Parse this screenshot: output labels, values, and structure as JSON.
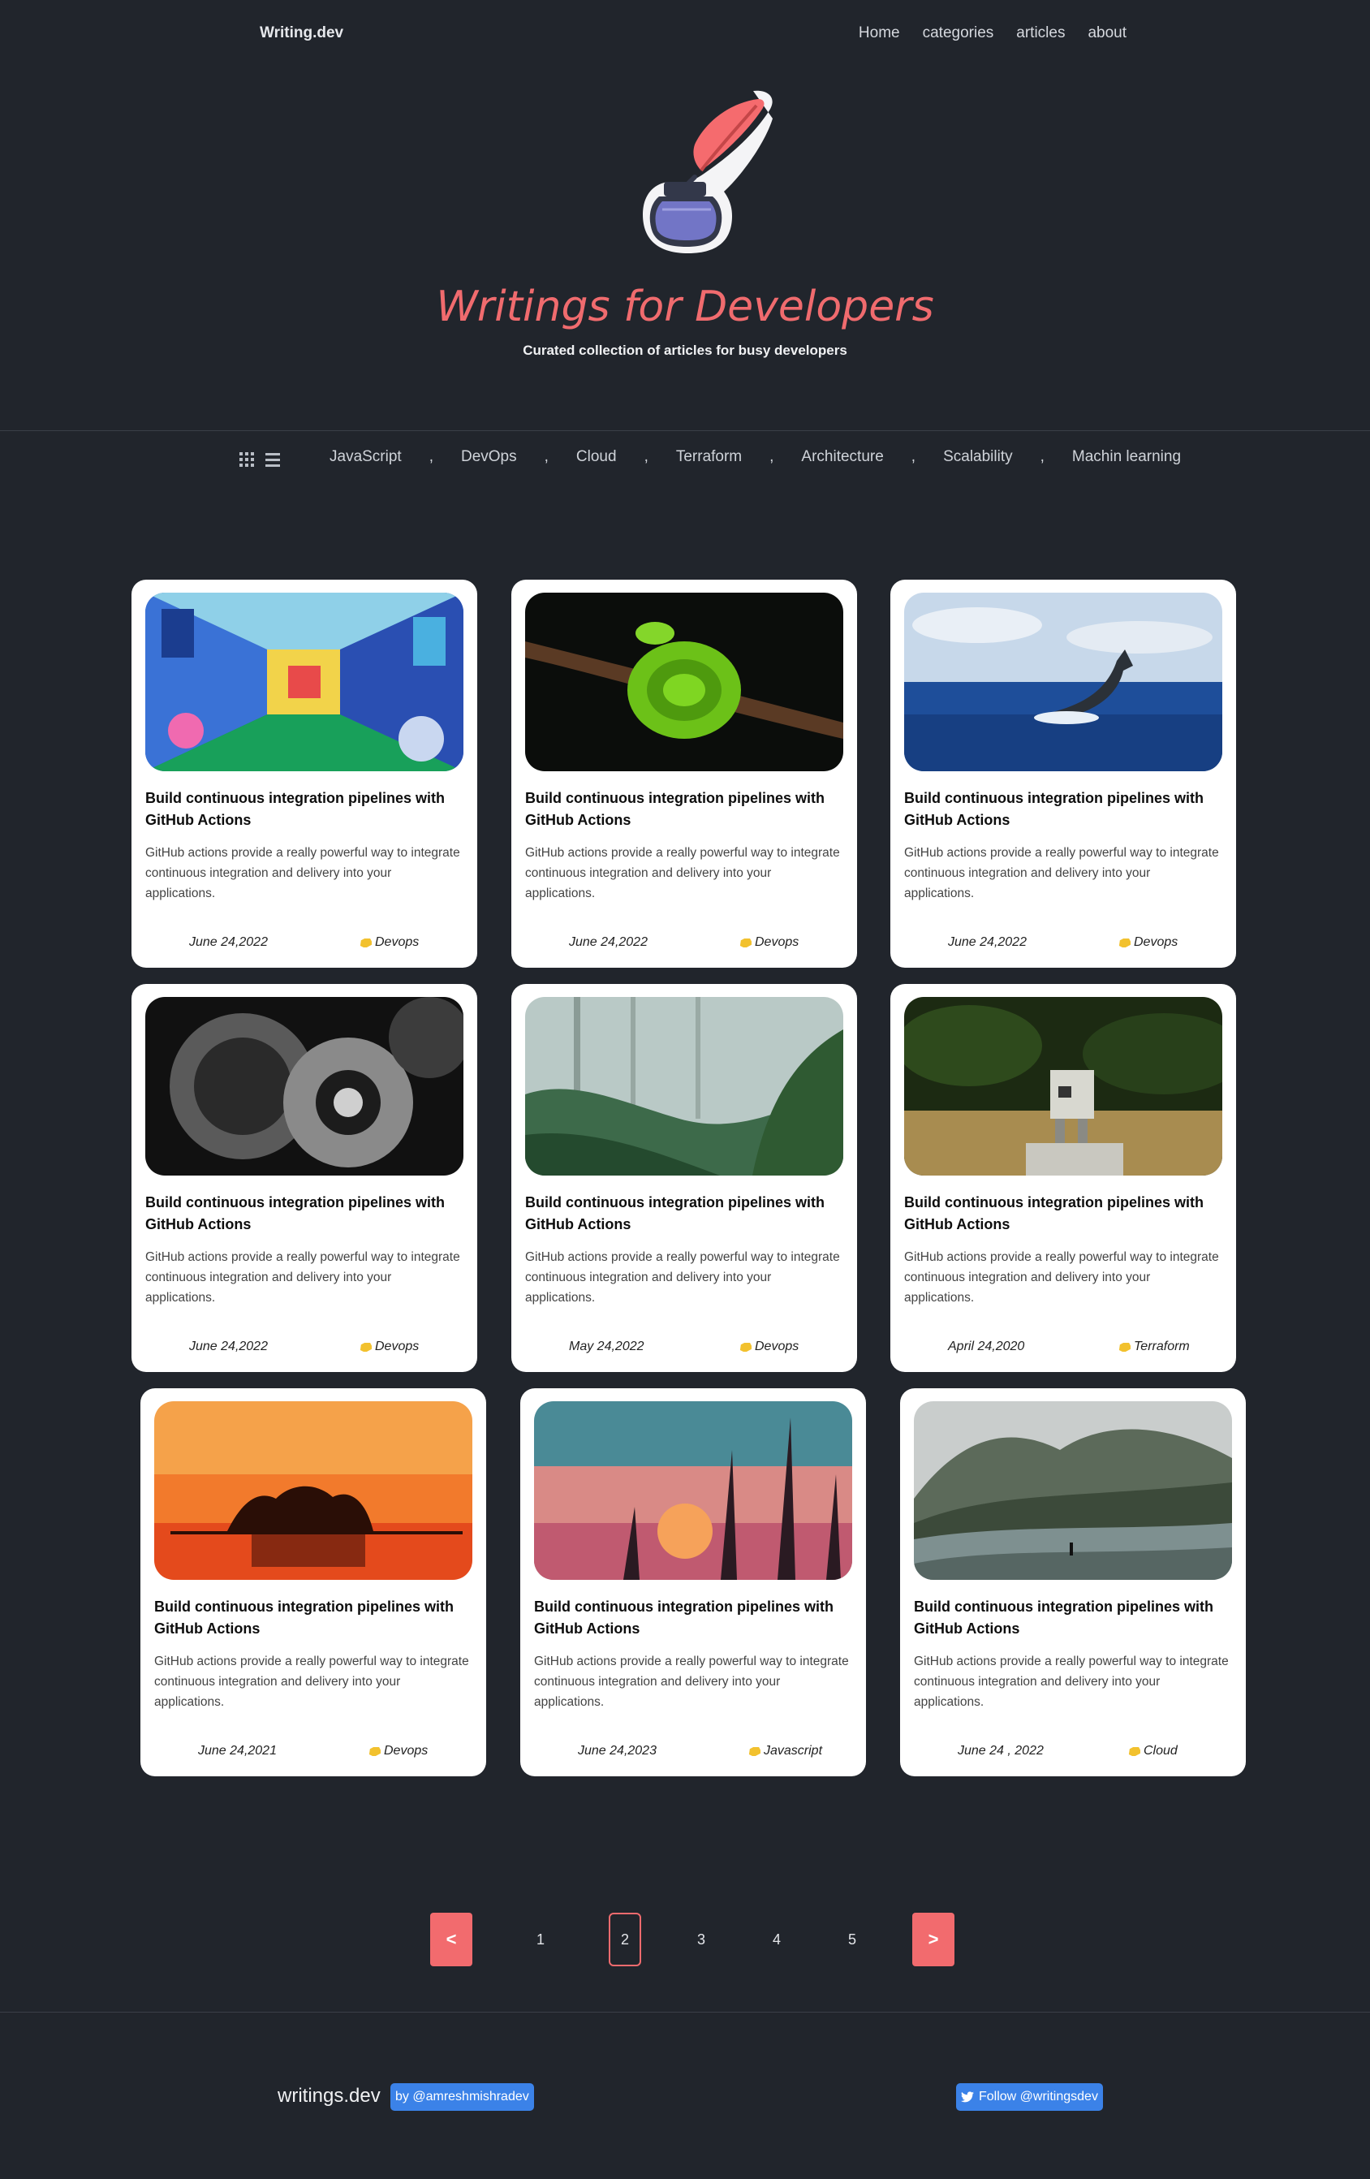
{
  "nav": {
    "brand": "Writing.dev",
    "links": [
      "Home",
      "categories",
      "articles",
      "about"
    ]
  },
  "hero": {
    "title": "Writings for Developers",
    "subtitle": "Curated collection of articles for busy developers",
    "logo_icon": "quill-inkpot-icon"
  },
  "categories": [
    "JavaScript",
    "DevOps",
    "Cloud",
    "Terraform",
    "Architecture",
    "Scalability",
    "Machin learning"
  ],
  "view_icons": [
    "grid-view-icon",
    "list-view-icon"
  ],
  "cards": [
    {
      "image": "abstract-colorful-corridor",
      "title": "Build continuous integration pipelines with GitHub Actions",
      "description": "GitHub actions provide a really powerful way to integrate continuous integration and delivery into your applications.",
      "date": "June 24,2022",
      "tag": "Devops"
    },
    {
      "image": "green-snake-on-branch",
      "title": "Build continuous integration pipelines with GitHub Actions",
      "description": "GitHub actions provide a really powerful way to integrate continuous integration and delivery into your applications.",
      "date": "June 24,2022",
      "tag": "Devops"
    },
    {
      "image": "whale-tail-ocean",
      "title": "Build continuous integration pipelines with GitHub Actions",
      "description": "GitHub actions provide a really powerful way to integrate continuous integration and delivery into your applications.",
      "date": "June 24,2022",
      "tag": "Devops"
    },
    {
      "image": "black-white-gears",
      "title": "Build continuous integration pipelines with GitHub Actions",
      "description": "GitHub actions provide a really powerful way to integrate continuous integration and delivery into your applications.",
      "date": "June 24,2022",
      "tag": "Devops"
    },
    {
      "image": "misty-jungle",
      "title": "Build continuous integration pipelines with GitHub Actions",
      "description": "GitHub actions provide a really powerful way to integrate continuous integration and delivery into your applications.",
      "date": "May 24,2022",
      "tag": "Devops"
    },
    {
      "image": "box-robot-in-field",
      "title": "Build continuous integration pipelines with GitHub Actions",
      "description": "GitHub actions provide a really powerful way to integrate continuous integration and delivery into your applications.",
      "date": "April 24,2020",
      "tag": "Terraform"
    },
    {
      "image": "sunset-island-trees",
      "title": "Build continuous integration pipelines with GitHub Actions",
      "description": "GitHub actions provide a really powerful way to integrate continuous integration and delivery into your applications.",
      "date": "June 24,2021",
      "tag": "Devops"
    },
    {
      "image": "sunset-grass-silhouette",
      "title": "Build continuous integration pipelines with GitHub Actions",
      "description": "GitHub actions provide a really powerful way to integrate continuous integration and delivery into your applications.",
      "date": "June 24,2023",
      "tag": "Javascript"
    },
    {
      "image": "foggy-mountain-river",
      "title": "Build continuous integration pipelines with GitHub Actions",
      "description": "GitHub actions provide a really powerful way to integrate continuous integration and delivery into your applications.",
      "date": "June 24 , 2022",
      "tag": "Cloud"
    }
  ],
  "pagination": {
    "prev": "<",
    "next": ">",
    "pages": [
      "1",
      "2",
      "3",
      "4",
      "5"
    ],
    "current": "2"
  },
  "footer": {
    "brand": "writings.dev",
    "author_badge": "by @amreshmishradev",
    "follow_badge": "Follow @writingsdev"
  },
  "colors": {
    "background": "#21252c",
    "accent": "#f26b6e",
    "badge": "#3b82e8",
    "card": "#ffffff"
  }
}
